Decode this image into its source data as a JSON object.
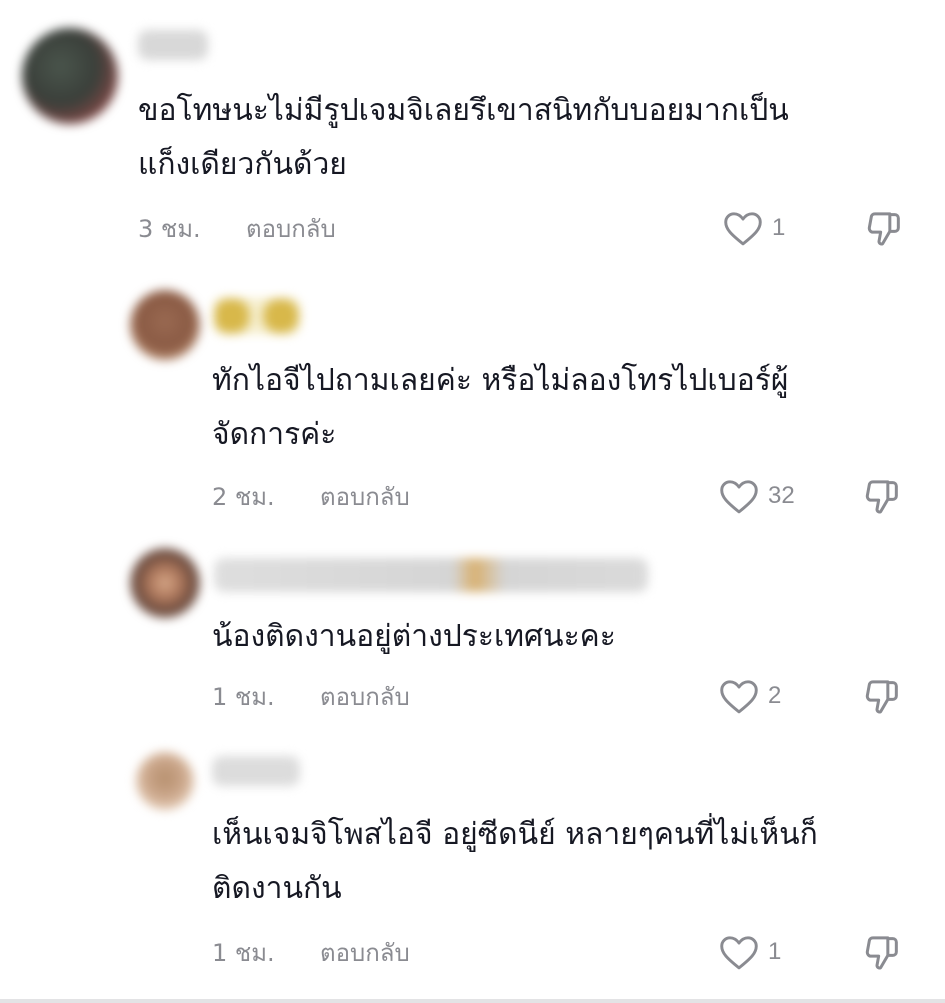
{
  "comments": [
    {
      "text_lines": [
        "ขอโทษนะไม่มีรูปเจมจิเลยรึเขาสนิทกับบอยมากเป็น",
        "แก็งเดียวกันด้วย"
      ],
      "time": "3 ชม.",
      "reply_label": "ตอบกลับ",
      "likes": "1",
      "avatar_colors": [
        "#3a3f3a",
        "#8b4a48"
      ],
      "username_color": "#d9d9d9"
    },
    {
      "text_lines": [
        "ทักไอจีไปถามเลยค่ะ หรือไม่ลองโทรไปเบอร์ผู้",
        "จัดการค่ะ"
      ],
      "time": "2 ชม.",
      "reply_label": "ตอบกลับ",
      "likes": "32",
      "avatar_colors": [
        "#8a5a44",
        "#c79b7a"
      ],
      "username_color": "#e6cf6a"
    },
    {
      "text_lines": [
        "น้องติดงานอยู่ต่างประเทศนะคะ"
      ],
      "time": "1 ชม.",
      "reply_label": "ตอบกลับ",
      "likes": "2",
      "avatar_colors": [
        "#6b4a3d",
        "#d7a98a"
      ],
      "username_color": "#d5d5d5"
    },
    {
      "text_lines": [
        "เห็นเจมจิโพสไอจี อยู่ซีดนีย์ หลายๆคนที่ไม่เห็นก็",
        "ติดงานกัน"
      ],
      "time": "1 ชม.",
      "reply_label": "ตอบกลับ",
      "likes": "1",
      "avatar_colors": [
        "#b6906e",
        "#e9d2bd"
      ],
      "username_color": "#dcdcdc"
    }
  ],
  "icons": {
    "like": "heart-outline-icon",
    "dislike": "thumbs-down-icon"
  },
  "colors": {
    "text": "#161823",
    "meta": "#8a8b91",
    "icon": "#8a8b91"
  }
}
